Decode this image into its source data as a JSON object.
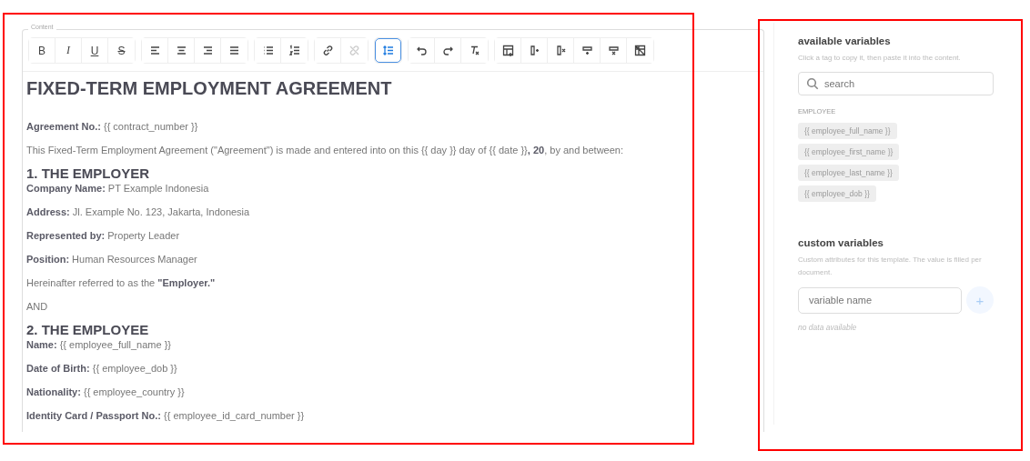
{
  "editor": {
    "legend": "Content",
    "toolbar": [
      [
        {
          "kind": "bold",
          "label": "B",
          "selected": false,
          "disabled": false
        },
        {
          "kind": "italic",
          "label": "I",
          "selected": false,
          "disabled": false
        },
        {
          "kind": "underline",
          "label": "U",
          "selected": false,
          "disabled": false
        },
        {
          "kind": "strike",
          "label": "S",
          "selected": false,
          "disabled": false
        }
      ],
      [
        {
          "kind": "alignleft",
          "selected": false,
          "disabled": false
        },
        {
          "kind": "aligncenter",
          "selected": false,
          "disabled": false
        },
        {
          "kind": "alignright",
          "selected": false,
          "disabled": false
        },
        {
          "kind": "justify",
          "selected": false,
          "disabled": false
        }
      ],
      [
        {
          "kind": "bullets",
          "selected": false,
          "disabled": false
        },
        {
          "kind": "numbering",
          "selected": false,
          "disabled": false
        }
      ],
      [
        {
          "kind": "link",
          "selected": false,
          "disabled": false
        },
        {
          "kind": "unlink",
          "selected": false,
          "disabled": true
        }
      ],
      [
        {
          "kind": "spacing",
          "selected": true,
          "disabled": false
        }
      ],
      [
        {
          "kind": "undo",
          "selected": false,
          "disabled": false
        },
        {
          "kind": "redo",
          "selected": false,
          "disabled": false
        },
        {
          "kind": "clear",
          "selected": false,
          "disabled": false
        }
      ],
      [
        {
          "kind": "table",
          "selected": false,
          "disabled": false
        },
        {
          "kind": "coladd",
          "selected": false,
          "disabled": false
        },
        {
          "kind": "coldel",
          "selected": false,
          "disabled": false
        },
        {
          "kind": "rowadd",
          "selected": false,
          "disabled": false
        },
        {
          "kind": "rowdel",
          "selected": false,
          "disabled": false
        },
        {
          "kind": "tabledel",
          "selected": false,
          "disabled": false
        }
      ]
    ],
    "blocks": [
      {
        "kind": "title",
        "text": "FIXED-TERM EMPLOYMENT AGREEMENT"
      },
      {
        "kind": "paragraph",
        "text": "**Agreement No.:** {{ contract_number }}"
      },
      {
        "kind": "paragraph",
        "text": "This Fixed-Term Employment Agreement (\"Agreement\") is made and entered into on this {{ day }} day of {{ date }}**, 20**, by and between:"
      },
      {
        "kind": "heading",
        "text": "1. THE EMPLOYER"
      },
      {
        "kind": "paragraph",
        "text": "**Company Name:** PT Example Indonesia"
      },
      {
        "kind": "paragraph",
        "text": "**Address:** Jl. Example No. 123, Jakarta, Indonesia"
      },
      {
        "kind": "paragraph",
        "text": "**Represented by:** Property Leader"
      },
      {
        "kind": "paragraph",
        "text": "**Position:** Human Resources Manager"
      },
      {
        "kind": "paragraph",
        "text": "Hereinafter referred to as the **\"Employer.\"**"
      },
      {
        "kind": "paragraph",
        "text": "AND"
      },
      {
        "kind": "heading",
        "text": "2. THE EMPLOYEE"
      },
      {
        "kind": "paragraph",
        "text": "**Name:** {{ employee_full_name }}"
      },
      {
        "kind": "paragraph",
        "text": "**Date of Birth:** {{ employee_dob }}"
      },
      {
        "kind": "paragraph",
        "text": "**Nationality:** {{ employee_country }}"
      },
      {
        "kind": "paragraph",
        "text": "**Identity Card / Passport No.:** {{ employee_id_card_number }}"
      }
    ]
  },
  "sidebar": {
    "available": {
      "title": "available variables",
      "hint": "Click a tag to copy it, then paste it into the content.",
      "search": {
        "placeholder": "search"
      },
      "group": "EMPLOYEE",
      "tags": [
        "{{ employee_full_name }}",
        "{{ employee_first_name }}",
        "{{ employee_last_name }}",
        "{{ employee_dob }}"
      ]
    },
    "custom": {
      "title": "custom variables",
      "hint": "Custom attributes for this template. The value is filled per document.",
      "field": {
        "placeholder": "variable name"
      },
      "add_button": "+",
      "empty": "no data available"
    }
  }
}
